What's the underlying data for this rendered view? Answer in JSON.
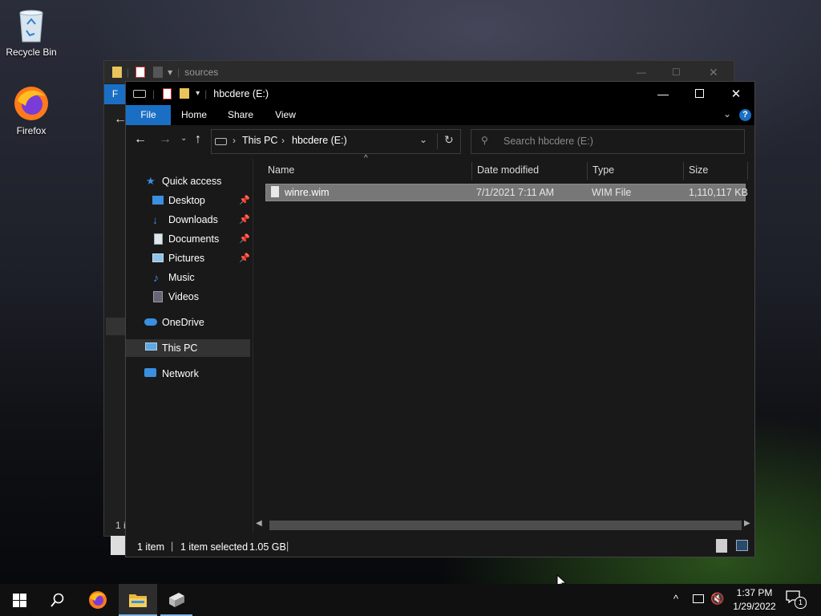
{
  "desktop": {
    "icons": [
      {
        "label": "Recycle Bin",
        "icon": "recycle-bin-icon"
      },
      {
        "label": "Firefox",
        "icon": "firefox-icon"
      }
    ]
  },
  "back_window": {
    "title": "sources",
    "partial_tab": "F",
    "partial_status": "1 i"
  },
  "window": {
    "title": "hbcdere (E:)",
    "ribbon_tabs": [
      "File",
      "Home",
      "Share",
      "View"
    ],
    "breadcrumb": [
      "This PC",
      "hbcdere (E:)"
    ],
    "search_placeholder": "Search hbcdere (E:)",
    "nav": {
      "quick_access": "Quick access",
      "pinned": [
        {
          "label": "Desktop",
          "icon": "desktop-folder-icon",
          "pinned": true
        },
        {
          "label": "Downloads",
          "icon": "downloads-folder-icon",
          "pinned": true
        },
        {
          "label": "Documents",
          "icon": "documents-folder-icon",
          "pinned": true
        },
        {
          "label": "Pictures",
          "icon": "pictures-folder-icon",
          "pinned": true
        },
        {
          "label": "Music",
          "icon": "music-folder-icon",
          "pinned": false
        },
        {
          "label": "Videos",
          "icon": "videos-folder-icon",
          "pinned": false
        }
      ],
      "onedrive": "OneDrive",
      "this_pc": "This PC",
      "network": "Network"
    },
    "columns": [
      "Name",
      "Date modified",
      "Type",
      "Size"
    ],
    "files": [
      {
        "name": "winre.wim",
        "date": "7/1/2021 7:11 AM",
        "type": "WIM File",
        "size": "1,110,117 KB"
      }
    ],
    "status": {
      "items": "1 item",
      "selected": "1 item selected",
      "size": "1.05 GB"
    }
  },
  "taskbar": {
    "time": "1:37 PM",
    "date": "1/29/2022",
    "notifications": "1",
    "accent": "#1a6fc4"
  }
}
